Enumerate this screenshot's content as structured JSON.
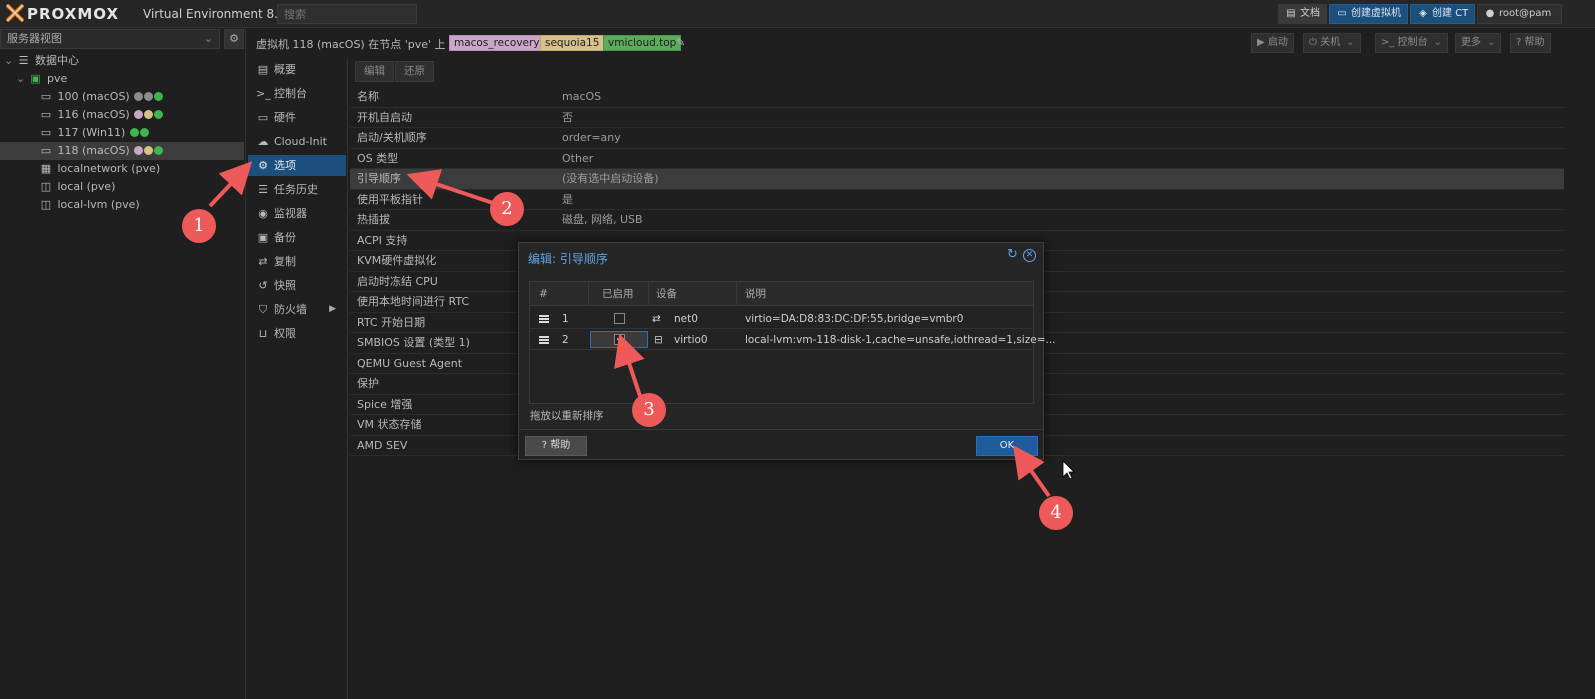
{
  "brand": {
    "name": "PROXMOX",
    "product": "Virtual Environment 8.3.0",
    "search_placeholder": "搜索"
  },
  "topbar": {
    "docs": "文档",
    "create_vm": "创建虚拟机",
    "create_ct": "创建 CT",
    "user": "root@pam"
  },
  "tree": {
    "view": "服务器视图",
    "items": [
      {
        "label": "数据中心",
        "icon": "datacenter-icon"
      },
      {
        "label": "pve",
        "icon": "node-icon"
      },
      {
        "label": "100 (macOS)",
        "icon": "vm-icon"
      },
      {
        "label": "116 (macOS)",
        "icon": "vm-icon"
      },
      {
        "label": "117 (Win11)",
        "icon": "vm-icon"
      },
      {
        "label": "118 (macOS)",
        "icon": "vm-icon"
      },
      {
        "label": "localnetwork (pve)",
        "icon": "network-icon"
      },
      {
        "label": "local (pve)",
        "icon": "storage-icon"
      },
      {
        "label": "local-lvm (pve)",
        "icon": "storage-icon"
      }
    ]
  },
  "header": {
    "title": "虚拟机 118 (macOS) 在节点 'pve' 上",
    "tags": [
      "macos_recovery",
      "sequoia15",
      "vmicloud.top"
    ],
    "start": "启动",
    "shutdown": "关机",
    "console": "控制台",
    "more": "更多",
    "help": "帮助"
  },
  "nav": [
    {
      "label": "概要",
      "icon": "summary-icon"
    },
    {
      "label": "控制台",
      "icon": "console-icon"
    },
    {
      "label": "硬件",
      "icon": "hardware-icon"
    },
    {
      "label": "Cloud-Init",
      "icon": "cloud-icon"
    },
    {
      "label": "选项",
      "icon": "gear-icon"
    },
    {
      "label": "任务历史",
      "icon": "list-icon"
    },
    {
      "label": "监视器",
      "icon": "eye-icon"
    },
    {
      "label": "备份",
      "icon": "save-icon"
    },
    {
      "label": "复制",
      "icon": "retweet-icon"
    },
    {
      "label": "快照",
      "icon": "history-icon"
    },
    {
      "label": "防火墙",
      "icon": "shield-icon"
    },
    {
      "label": "权限",
      "icon": "unlock-icon"
    }
  ],
  "options": {
    "edit": "编辑",
    "revert": "还原",
    "rows": [
      {
        "key": "名称",
        "value": "macOS"
      },
      {
        "key": "开机自启动",
        "value": "否"
      },
      {
        "key": "启动/关机顺序",
        "value": "order=any"
      },
      {
        "key": "OS 类型",
        "value": "Other"
      },
      {
        "key": "引导顺序",
        "value": "(没有选中启动设备)"
      },
      {
        "key": "使用平板指针",
        "value": "是"
      },
      {
        "key": "热插拔",
        "value": "磁盘, 网络, USB"
      },
      {
        "key": "ACPI 支持",
        "value": ""
      },
      {
        "key": "KVM硬件虚拟化",
        "value": ""
      },
      {
        "key": "启动时冻结 CPU",
        "value": ""
      },
      {
        "key": "使用本地时间进行 RTC",
        "value": ""
      },
      {
        "key": "RTC 开始日期",
        "value": ""
      },
      {
        "key": "SMBIOS 设置 (类型 1)",
        "value": ""
      },
      {
        "key": "QEMU Guest Agent",
        "value": ""
      },
      {
        "key": "保护",
        "value": ""
      },
      {
        "key": "Spice 增强",
        "value": ""
      },
      {
        "key": "VM 状态存储",
        "value": ""
      },
      {
        "key": "AMD SEV",
        "value": ""
      }
    ]
  },
  "modal": {
    "title": "编辑: 引导顺序",
    "columns": [
      "#",
      "已启用",
      "设备",
      "说明"
    ],
    "rows": [
      {
        "num": "1",
        "enabled": false,
        "device": "net0",
        "device_icon": "exchange-icon",
        "desc": "virtio=DA:D8:83:DC:DF:55,bridge=vmbr0"
      },
      {
        "num": "2",
        "enabled": true,
        "device": "virtio0",
        "device_icon": "disk-icon",
        "desc": "local-lvm:vm-118-disk-1,cache=unsafe,iothread=1,size=..."
      }
    ],
    "hint": "拖放以重新排序",
    "help": "帮助",
    "ok": "OK"
  },
  "annotations": [
    "1",
    "2",
    "3",
    "4"
  ],
  "colors": {
    "accent": "#1d4f7d",
    "annotation": "#ee5a5a",
    "tag_macos": "#c9a7c9",
    "tag_sequoia": "#d8c08a",
    "tag_vmicloud": "#5bab5b",
    "status_green": "#3fb54b",
    "status_grey": "#8c8c8c"
  }
}
